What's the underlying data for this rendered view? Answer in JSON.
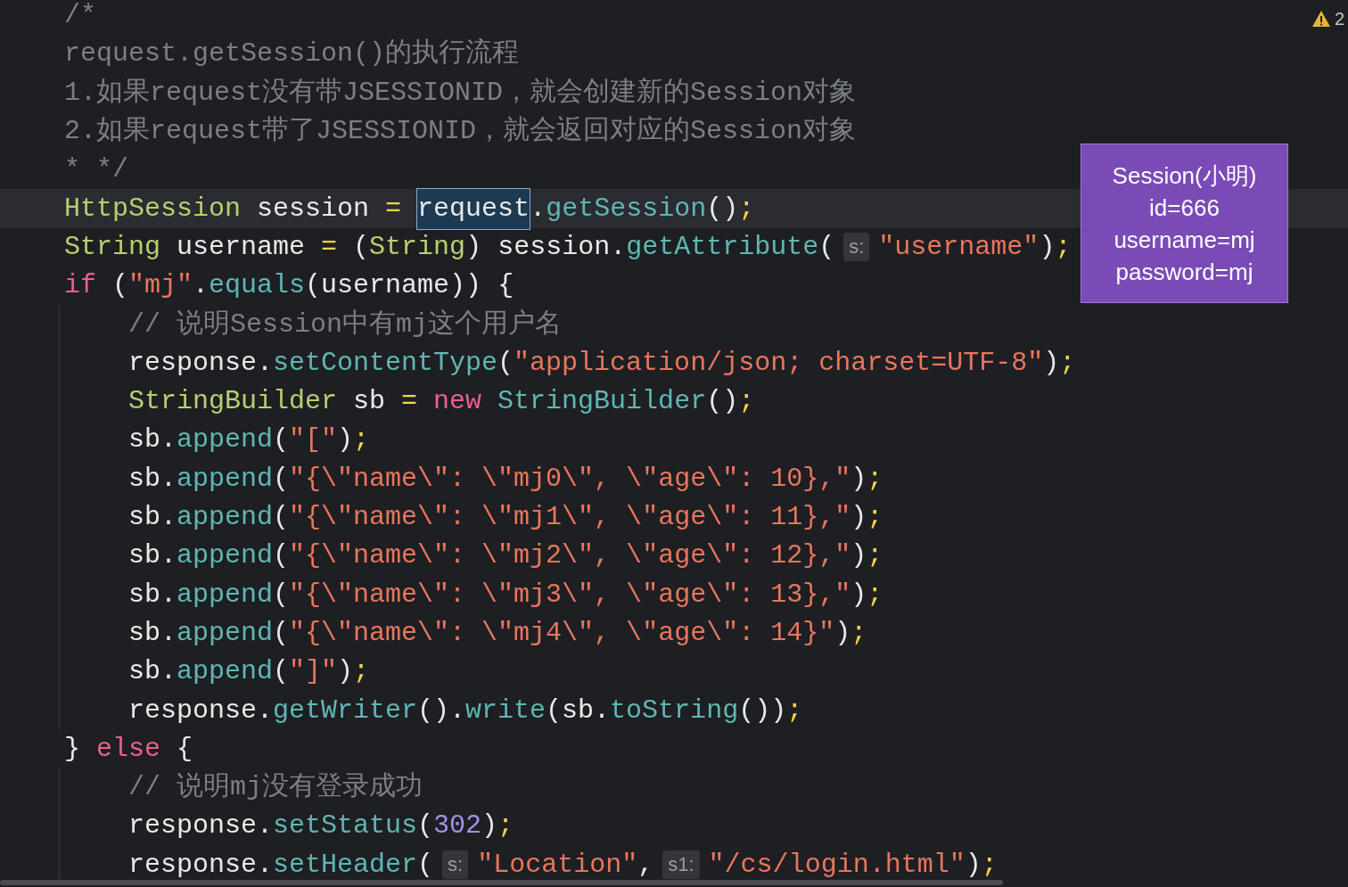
{
  "editor": {
    "warnings": {
      "count": "2"
    },
    "lines": [
      {
        "current": false,
        "tokens": [
          {
            "kind": "comment",
            "text": "/*"
          }
        ]
      },
      {
        "current": false,
        "tokens": [
          {
            "kind": "comment",
            "text": "request.getSession()的执行流程"
          }
        ]
      },
      {
        "current": false,
        "tokens": [
          {
            "kind": "comment",
            "text": "1.如果request没有带JSESSIONID，就会创建新的Session对象"
          }
        ]
      },
      {
        "current": false,
        "tokens": [
          {
            "kind": "comment",
            "text": "2.如果request带了JSESSIONID，就会返回对应的Session对象"
          }
        ]
      },
      {
        "current": false,
        "tokens": [
          {
            "kind": "comment",
            "text": "* */"
          }
        ]
      },
      {
        "current": true,
        "tokens": [
          {
            "kind": "type",
            "text": "HttpSession"
          },
          {
            "kind": "plain",
            "text": " session "
          },
          {
            "kind": "op",
            "text": "= "
          },
          {
            "kind": "selected",
            "text": "request"
          },
          {
            "kind": "plain",
            "text": "."
          },
          {
            "kind": "method",
            "text": "getSession"
          },
          {
            "kind": "plain",
            "text": "()"
          },
          {
            "kind": "op",
            "text": ";"
          }
        ]
      },
      {
        "current": false,
        "tokens": [
          {
            "kind": "type",
            "text": "String"
          },
          {
            "kind": "plain",
            "text": " username "
          },
          {
            "kind": "op",
            "text": "="
          },
          {
            "kind": "plain",
            "text": " ("
          },
          {
            "kind": "type",
            "text": "String"
          },
          {
            "kind": "plain",
            "text": ") session."
          },
          {
            "kind": "method",
            "text": "getAttribute"
          },
          {
            "kind": "plain",
            "text": "("
          },
          {
            "kind": "hint",
            "text": "s:"
          },
          {
            "kind": "string",
            "text": "\"username\""
          },
          {
            "kind": "plain",
            "text": ")"
          },
          {
            "kind": "op",
            "text": ";"
          }
        ]
      },
      {
        "current": false,
        "tokens": [
          {
            "kind": "keyword",
            "text": "if"
          },
          {
            "kind": "plain",
            "text": " ("
          },
          {
            "kind": "string",
            "text": "\"mj\""
          },
          {
            "kind": "plain",
            "text": "."
          },
          {
            "kind": "method",
            "text": "equals"
          },
          {
            "kind": "plain",
            "text": "(username)) {"
          }
        ],
        "children": [
          {
            "current": false,
            "tokens": [
              {
                "kind": "comment",
                "text": "// 说明Session中有mj这个用户名"
              }
            ]
          },
          {
            "current": false,
            "tokens": [
              {
                "kind": "plain",
                "text": "response."
              },
              {
                "kind": "method",
                "text": "setContentType"
              },
              {
                "kind": "plain",
                "text": "("
              },
              {
                "kind": "string",
                "text": "\"application/json; charset=UTF-8\""
              },
              {
                "kind": "plain",
                "text": ")"
              },
              {
                "kind": "op",
                "text": ";"
              }
            ]
          },
          {
            "current": false,
            "tokens": [
              {
                "kind": "type",
                "text": "StringBuilder"
              },
              {
                "kind": "plain",
                "text": " sb "
              },
              {
                "kind": "op",
                "text": "= "
              },
              {
                "kind": "keyword",
                "text": "new "
              },
              {
                "kind": "method",
                "text": "StringBuilder"
              },
              {
                "kind": "plain",
                "text": "()"
              },
              {
                "kind": "op",
                "text": ";"
              }
            ]
          },
          {
            "current": false,
            "tokens": [
              {
                "kind": "plain",
                "text": "sb."
              },
              {
                "kind": "method",
                "text": "append"
              },
              {
                "kind": "plain",
                "text": "("
              },
              {
                "kind": "string",
                "text": "\"[\""
              },
              {
                "kind": "plain",
                "text": ")"
              },
              {
                "kind": "op",
                "text": ";"
              }
            ]
          },
          {
            "current": false,
            "tokens": [
              {
                "kind": "plain",
                "text": "sb."
              },
              {
                "kind": "method",
                "text": "append"
              },
              {
                "kind": "plain",
                "text": "("
              },
              {
                "kind": "string",
                "text": "\"{\\\"name\\\": \\\"mj0\\\", \\\"age\\\": 10},\""
              },
              {
                "kind": "plain",
                "text": ")"
              },
              {
                "kind": "op",
                "text": ";"
              }
            ]
          },
          {
            "current": false,
            "tokens": [
              {
                "kind": "plain",
                "text": "sb."
              },
              {
                "kind": "method",
                "text": "append"
              },
              {
                "kind": "plain",
                "text": "("
              },
              {
                "kind": "string",
                "text": "\"{\\\"name\\\": \\\"mj1\\\", \\\"age\\\": 11},\""
              },
              {
                "kind": "plain",
                "text": ")"
              },
              {
                "kind": "op",
                "text": ";"
              }
            ]
          },
          {
            "current": false,
            "tokens": [
              {
                "kind": "plain",
                "text": "sb."
              },
              {
                "kind": "method",
                "text": "append"
              },
              {
                "kind": "plain",
                "text": "("
              },
              {
                "kind": "string",
                "text": "\"{\\\"name\\\": \\\"mj2\\\", \\\"age\\\": 12},\""
              },
              {
                "kind": "plain",
                "text": ")"
              },
              {
                "kind": "op",
                "text": ";"
              }
            ]
          },
          {
            "current": false,
            "tokens": [
              {
                "kind": "plain",
                "text": "sb."
              },
              {
                "kind": "method",
                "text": "append"
              },
              {
                "kind": "plain",
                "text": "("
              },
              {
                "kind": "string",
                "text": "\"{\\\"name\\\": \\\"mj3\\\", \\\"age\\\": 13},\""
              },
              {
                "kind": "plain",
                "text": ")"
              },
              {
                "kind": "op",
                "text": ";"
              }
            ]
          },
          {
            "current": false,
            "tokens": [
              {
                "kind": "plain",
                "text": "sb."
              },
              {
                "kind": "method",
                "text": "append"
              },
              {
                "kind": "plain",
                "text": "("
              },
              {
                "kind": "string",
                "text": "\"{\\\"name\\\": \\\"mj4\\\", \\\"age\\\": 14}\""
              },
              {
                "kind": "plain",
                "text": ")"
              },
              {
                "kind": "op",
                "text": ";"
              }
            ]
          },
          {
            "current": false,
            "tokens": [
              {
                "kind": "plain",
                "text": "sb."
              },
              {
                "kind": "method",
                "text": "append"
              },
              {
                "kind": "plain",
                "text": "("
              },
              {
                "kind": "string",
                "text": "\"]\""
              },
              {
                "kind": "plain",
                "text": ")"
              },
              {
                "kind": "op",
                "text": ";"
              }
            ]
          },
          {
            "current": false,
            "tokens": [
              {
                "kind": "plain",
                "text": "response."
              },
              {
                "kind": "method",
                "text": "getWriter"
              },
              {
                "kind": "plain",
                "text": "()."
              },
              {
                "kind": "method",
                "text": "write"
              },
              {
                "kind": "plain",
                "text": "(sb."
              },
              {
                "kind": "method",
                "text": "toString"
              },
              {
                "kind": "plain",
                "text": "())"
              },
              {
                "kind": "op",
                "text": ";"
              }
            ]
          }
        ]
      },
      {
        "current": false,
        "tokens": [
          {
            "kind": "plain",
            "text": "} "
          },
          {
            "kind": "keyword",
            "text": "else"
          },
          {
            "kind": "plain",
            "text": " {"
          }
        ],
        "children": [
          {
            "current": false,
            "tokens": [
              {
                "kind": "comment",
                "text": "// 说明mj没有登录成功"
              }
            ]
          },
          {
            "current": false,
            "tokens": [
              {
                "kind": "plain",
                "text": "response."
              },
              {
                "kind": "method",
                "text": "setStatus"
              },
              {
                "kind": "plain",
                "text": "("
              },
              {
                "kind": "number",
                "text": "302"
              },
              {
                "kind": "plain",
                "text": ")"
              },
              {
                "kind": "op",
                "text": ";"
              }
            ]
          },
          {
            "current": false,
            "tokens": [
              {
                "kind": "plain",
                "text": "response."
              },
              {
                "kind": "method",
                "text": "setHeader"
              },
              {
                "kind": "plain",
                "text": "("
              },
              {
                "kind": "hint",
                "text": "s:"
              },
              {
                "kind": "string",
                "text": "\"Location\""
              },
              {
                "kind": "plain",
                "text": ","
              },
              {
                "kind": "hint",
                "text": "s1:"
              },
              {
                "kind": "string",
                "text": "\"/cs/login.html\""
              },
              {
                "kind": "plain",
                "text": ")"
              },
              {
                "kind": "op",
                "text": ";"
              }
            ]
          }
        ]
      }
    ]
  },
  "callout": {
    "lines": [
      "Session(小明)",
      "id=666",
      "username=mj",
      "password=mj"
    ]
  }
}
